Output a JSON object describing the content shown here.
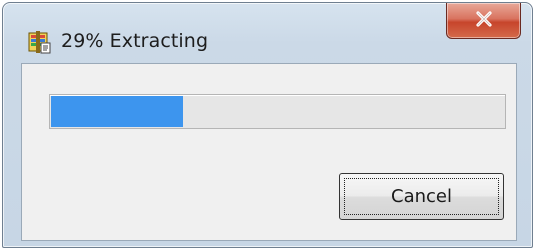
{
  "window": {
    "title": "29% Extracting",
    "icon": "archive-extract-icon"
  },
  "titlebar": {
    "close_icon": "close-icon",
    "close_color": "#c7452c"
  },
  "progress": {
    "value_percent": 29,
    "fill_color": "#3d95ee"
  },
  "buttons": {
    "cancel_label": "Cancel"
  }
}
